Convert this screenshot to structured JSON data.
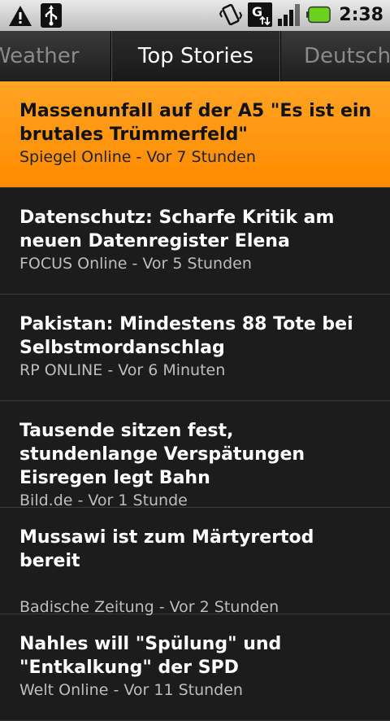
{
  "statusbar": {
    "time": "2:38",
    "icons": [
      "warning-icon",
      "usb-icon",
      "vibrate-icon",
      "data-3g-icon",
      "signal-icon",
      "battery-icon"
    ],
    "battery_color": "#6ad11f"
  },
  "tabs": {
    "left": "Weather",
    "active": "Top Stories",
    "right": "Deutschland"
  },
  "accent_color": "#ff9a1a",
  "stories": [
    {
      "headline": "Massenunfall auf der A5 \"Es ist ein brutales Trümmerfeld\"",
      "source": "Spiegel Online",
      "time": "Vor 7 Stunden",
      "meta": "Spiegel Online - Vor 7 Stunden"
    },
    {
      "headline": "Datenschutz: Scharfe Kritik am neuen Datenregister Elena",
      "source": "FOCUS Online",
      "time": "Vor 5 Stunden",
      "meta": "FOCUS Online - Vor 5 Stunden"
    },
    {
      "headline": "Pakistan: Mindestens 88 Tote bei Selbstmordanschlag",
      "source": "RP ONLINE",
      "time": "Vor 6 Minuten",
      "meta": "RP ONLINE - Vor 6 Minuten"
    },
    {
      "headline": "Tausende sitzen fest, stundenlange Verspätungen Eisregen legt Bahn",
      "source": "Bild.de",
      "time": "Vor 1 Stunde",
      "meta": "Bild.de - Vor 1 Stunde"
    },
    {
      "headline": "Mussawi ist zum Märtyrertod bereit",
      "source": "Badische Zeitung",
      "time": "Vor 2 Stunden",
      "meta": "Badische Zeitung - Vor 2 Stunden"
    },
    {
      "headline": "Nahles will \"Spülung\" und \"Entkalkung\" der SPD",
      "source": "Welt Online",
      "time": "Vor 11 Stunden",
      "meta": "Welt Online - Vor 11 Stunden"
    }
  ]
}
